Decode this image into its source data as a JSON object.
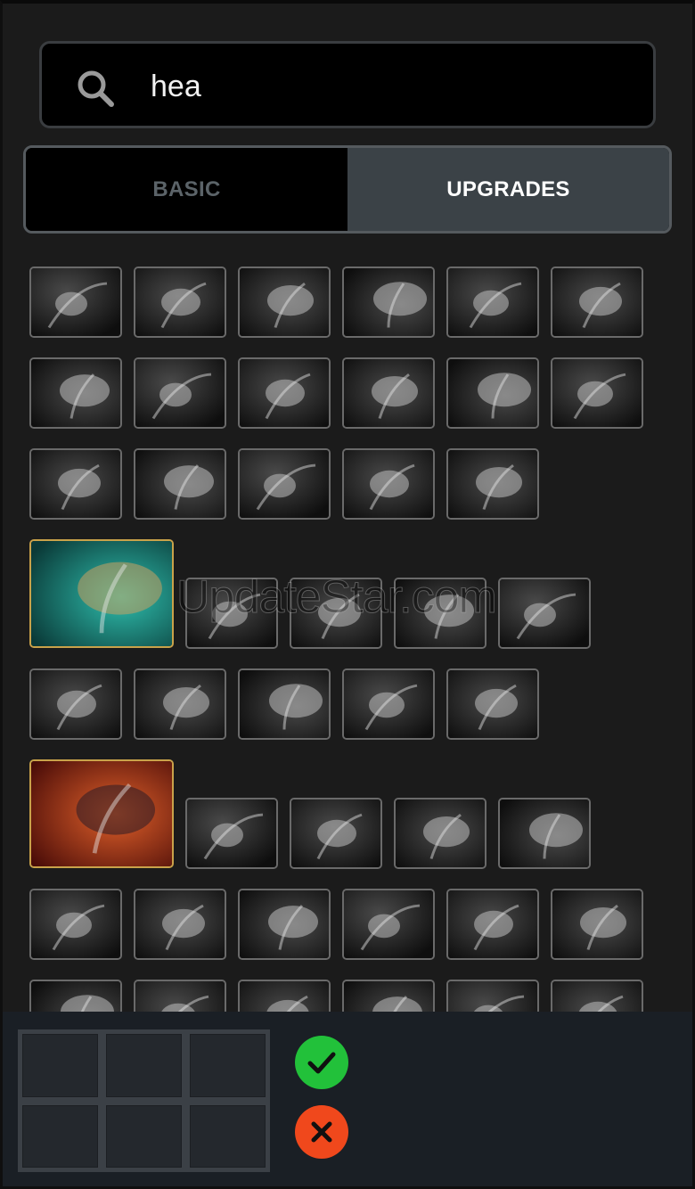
{
  "search": {
    "value": "hea",
    "icon": "search-icon"
  },
  "tabs": [
    {
      "label": "BASIC",
      "active": false
    },
    {
      "label": "UPGRADES",
      "active": true
    }
  ],
  "watermark": "UpdateStar.com",
  "items": [
    {
      "name": "item-torch",
      "kind": "small"
    },
    {
      "name": "item-cloak",
      "kind": "small"
    },
    {
      "name": "item-boots-armored",
      "kind": "small"
    },
    {
      "name": "item-boots",
      "kind": "small"
    },
    {
      "name": "item-gauntlet",
      "kind": "small"
    },
    {
      "name": "item-wand",
      "kind": "small"
    },
    {
      "name": "item-ring-a",
      "kind": "small"
    },
    {
      "name": "item-orb",
      "kind": "small"
    },
    {
      "name": "item-ring-b",
      "kind": "small"
    },
    {
      "name": "item-heart-crest",
      "kind": "small"
    },
    {
      "name": "item-chain-pendant",
      "kind": "small"
    },
    {
      "name": "item-amulet",
      "kind": "small"
    },
    {
      "name": "item-skull-mask",
      "kind": "small"
    },
    {
      "name": "item-shield",
      "kind": "small"
    },
    {
      "name": "item-band",
      "kind": "small"
    },
    {
      "name": "item-horn",
      "kind": "small"
    },
    {
      "name": "item-golem",
      "kind": "small"
    },
    {
      "name": "item-eagle-helm",
      "kind": "big",
      "color": "teal"
    },
    {
      "name": "item-claw",
      "kind": "small"
    },
    {
      "name": "item-shards",
      "kind": "small"
    },
    {
      "name": "item-wing",
      "kind": "small"
    },
    {
      "name": "item-sceptre",
      "kind": "small"
    },
    {
      "name": "item-spear",
      "kind": "small"
    },
    {
      "name": "item-tome",
      "kind": "small"
    },
    {
      "name": "item-dagger",
      "kind": "small"
    },
    {
      "name": "item-vortex",
      "kind": "small"
    },
    {
      "name": "item-armor",
      "kind": "small"
    },
    {
      "name": "item-flame-heart",
      "kind": "big",
      "color": "red"
    },
    {
      "name": "item-bird-mask",
      "kind": "small"
    },
    {
      "name": "item-beast-helm",
      "kind": "small"
    },
    {
      "name": "item-shatter",
      "kind": "small"
    },
    {
      "name": "item-medallion",
      "kind": "small"
    },
    {
      "name": "item-tower-shield",
      "kind": "small"
    },
    {
      "name": "item-mane",
      "kind": "small"
    },
    {
      "name": "item-rose",
      "kind": "small"
    },
    {
      "name": "item-hood",
      "kind": "small"
    },
    {
      "name": "item-blade",
      "kind": "small"
    },
    {
      "name": "item-staff",
      "kind": "small"
    },
    {
      "name": "item-row8-a",
      "kind": "small"
    },
    {
      "name": "item-row8-b",
      "kind": "small"
    },
    {
      "name": "item-row8-c",
      "kind": "small"
    },
    {
      "name": "item-row8-d",
      "kind": "small"
    },
    {
      "name": "item-row8-e",
      "kind": "small"
    },
    {
      "name": "item-row8-f",
      "kind": "small"
    }
  ],
  "actions": {
    "confirm_icon": "check-icon",
    "cancel_icon": "close-icon",
    "confirm_color": "#22c13a",
    "cancel_color": "#f0481c"
  },
  "inventory": {
    "slots": 6
  }
}
